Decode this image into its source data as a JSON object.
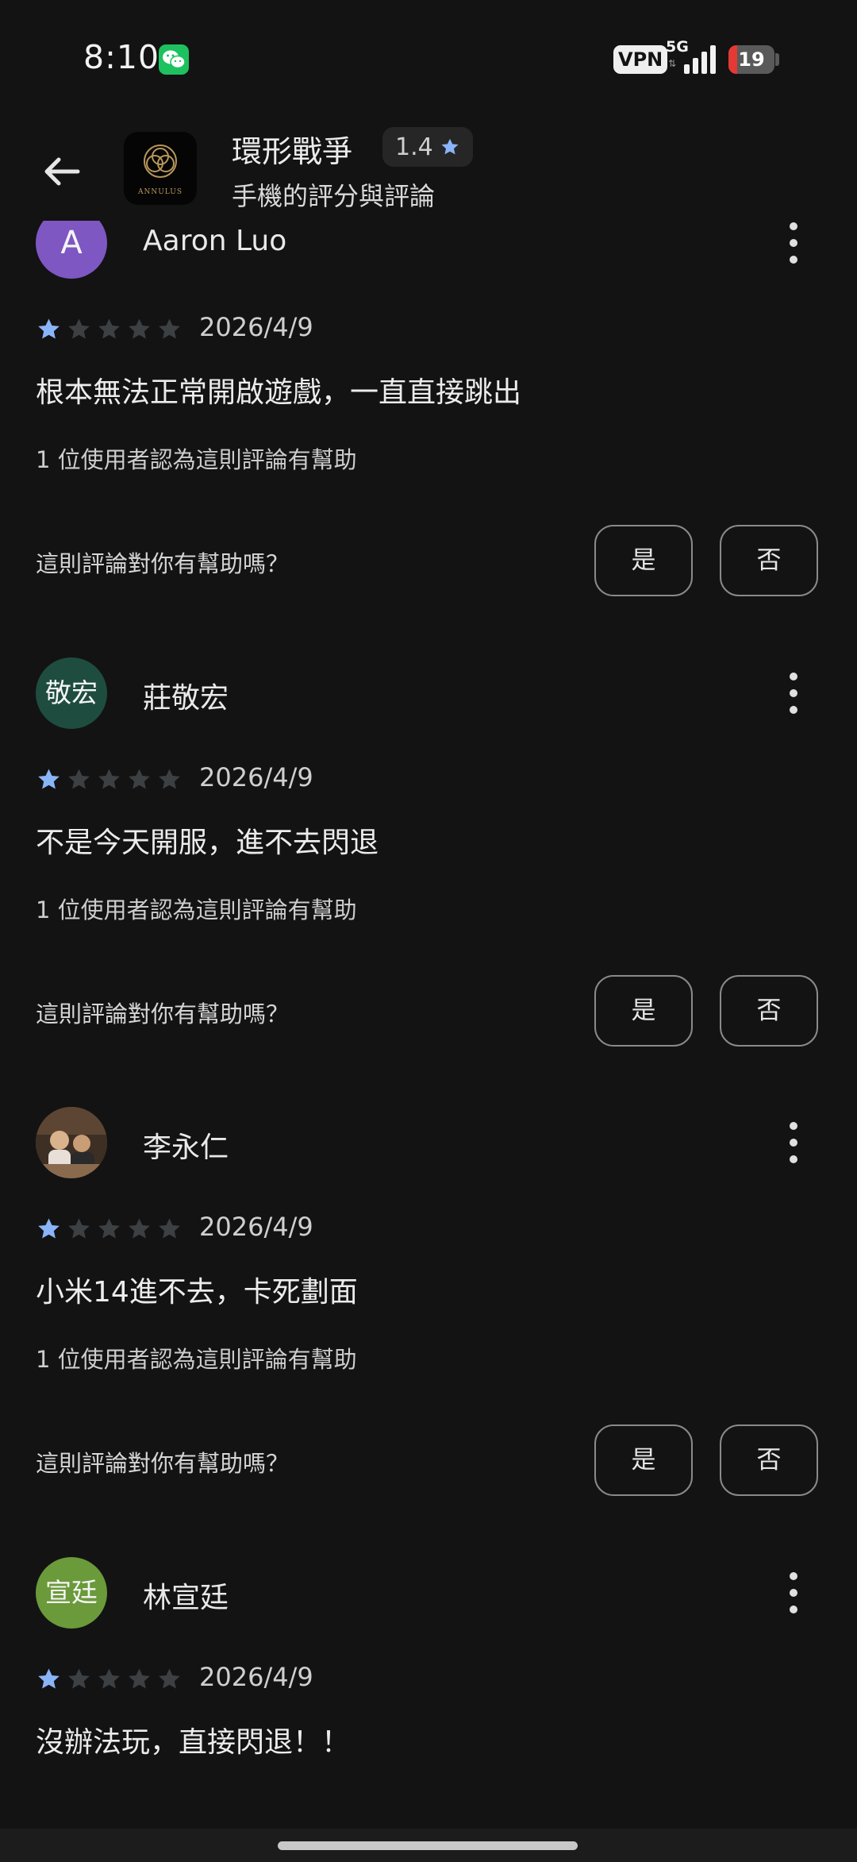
{
  "status_bar": {
    "time": "8:10",
    "vpn_label": "VPN",
    "network_label": "5G",
    "battery_level": "19",
    "icons": [
      "wechat-icon",
      "signal-icon",
      "battery-icon"
    ]
  },
  "header": {
    "app_name": "環形戰爭",
    "rating": "1.4",
    "subtitle": "手機的評分與評論",
    "app_icon_text": "ANNULUS"
  },
  "colors": {
    "background": "#131313",
    "star_filled": "#8ab4f8",
    "star_empty": "#3c4043"
  },
  "reviews": [
    {
      "author": "Aaron Luo",
      "avatar_text": "A",
      "avatar_color": "#7e57c2",
      "stars": 1,
      "date": "2026/4/9",
      "text": "根本無法正常開啟遊戲，一直直接跳出",
      "helpful_count": "1 位使用者認為這則評論有幫助",
      "helpful_question": "這則評論對你有幫助嗎？",
      "yes": "是",
      "no": "否"
    },
    {
      "author": "莊敬宏",
      "avatar_text": "敬宏",
      "avatar_color": "#1e4d3f",
      "stars": 1,
      "date": "2026/4/9",
      "text": "不是今天開服，進不去閃退",
      "helpful_count": "1 位使用者認為這則評論有幫助",
      "helpful_question": "這則評論對你有幫助嗎？",
      "yes": "是",
      "no": "否"
    },
    {
      "author": "李永仁",
      "avatar_text": "",
      "avatar_color": "#6b5440",
      "stars": 1,
      "date": "2026/4/9",
      "text": "小米14進不去，卡死劃面",
      "helpful_count": "1 位使用者認為這則評論有幫助",
      "helpful_question": "這則評論對你有幫助嗎？",
      "yes": "是",
      "no": "否"
    },
    {
      "author": "林宣廷",
      "avatar_text": "宣廷",
      "avatar_color": "#6a9a3a",
      "stars": 1,
      "date": "2026/4/9",
      "text": "沒辦法玩，直接閃退！！"
    }
  ]
}
